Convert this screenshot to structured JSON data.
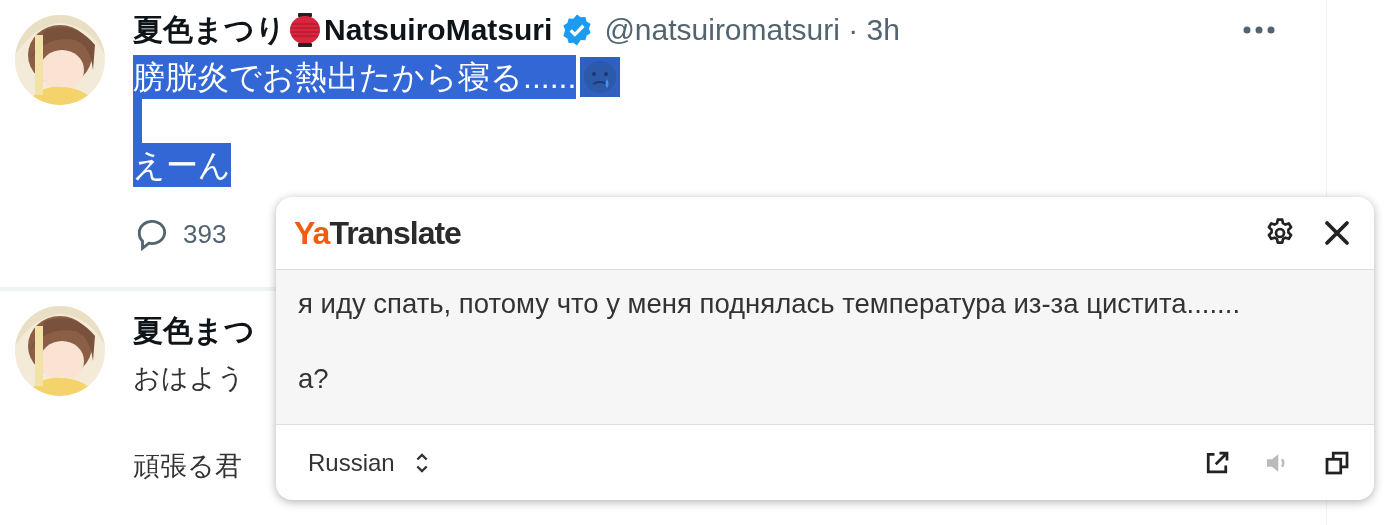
{
  "posts": [
    {
      "name": "夏色まつり",
      "name_suffix": "NatsuiroMatsuri",
      "verified": true,
      "handle": "@natsuiromatsuri · 3h",
      "selected": true,
      "paragraphs": [
        "膀胱炎でお熱出たから寝る......",
        "えーん"
      ],
      "replies": "393"
    },
    {
      "name": "夏色まつ",
      "selected": false,
      "paragraphs": [
        "おはよう",
        "頑張る君"
      ]
    }
  ],
  "translator": {
    "brand_prefix": "Ya",
    "brand": "Translate",
    "result": [
      "я иду спать, потому что у меня поднялась температура из-за цистита.......",
      "а?"
    ],
    "language": "Russian",
    "sound_disabled": true
  }
}
